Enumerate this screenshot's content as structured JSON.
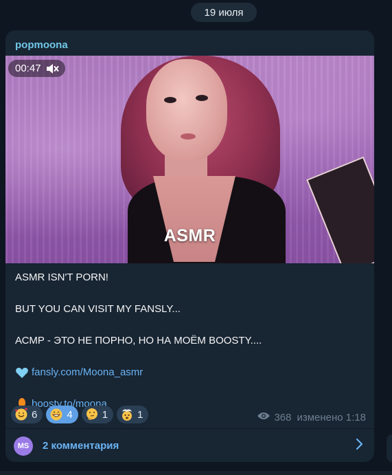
{
  "date_separator": "19 июля",
  "post": {
    "channel_name": "popmoona",
    "video": {
      "duration": "00:47",
      "overlay_label": "ASMR",
      "muted": true
    },
    "text_lines": [
      "ASMR ISN'T PORN!",
      "BUT YOU CAN VISIT MY FANSLY...",
      "АСМР - ЭТО НЕ ПОРНО, НО НА МОЁМ BOOSTY...."
    ],
    "links": [
      {
        "icon": "light-blue-heart-icon",
        "text": "fansly.com/Moona_asmr"
      },
      {
        "icon": "orange-balloon-icon",
        "text": "boosty.to/moona"
      }
    ],
    "reactions": [
      {
        "icon": "smiling-face-with-hearts-icon",
        "count": "6",
        "selected": false
      },
      {
        "icon": "grinning-face-icon",
        "count": "4",
        "selected": true
      },
      {
        "icon": "thinking-face-icon",
        "count": "1",
        "selected": false
      },
      {
        "icon": "exploding-head-icon",
        "count": "1",
        "selected": false
      }
    ],
    "views": "368",
    "edited_label": "изменено 1:18",
    "comments": {
      "avatar_initials": "MS",
      "label": "2 комментария"
    }
  },
  "colors": {
    "background": "#0e1621",
    "bubble": "#182533",
    "accent": "#6ab3f3",
    "channel_name": "#70c7e6",
    "reaction_selected": "#5fa0e6"
  }
}
